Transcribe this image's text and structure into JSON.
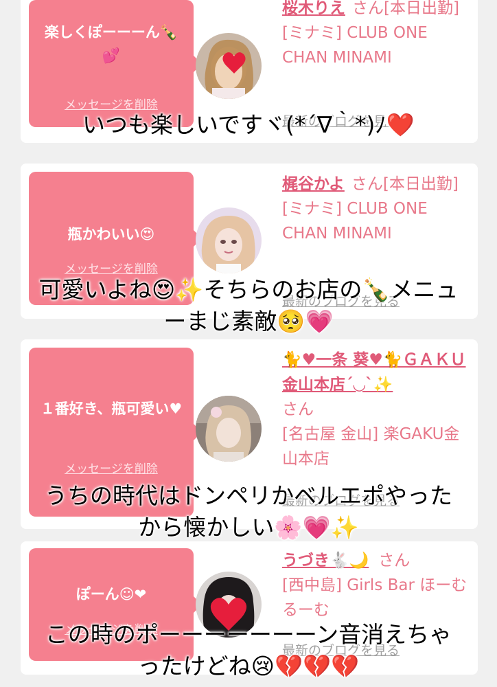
{
  "cards": [
    {
      "message": "楽しくぽーーーん🍾💕",
      "delete_label": "メッセージを削除",
      "name": "桜木りえ",
      "honorific_status": "さん[本日出勤]",
      "shop": "[ミナミ] CLUB ONE CHAN MINAMI",
      "blog_label": "最新のブログを見る",
      "avatar_icon": "heart-emoji-sticker"
    },
    {
      "message": "瓶かわいい😍",
      "delete_label": "メッセージを削除",
      "name": "梶谷かよ",
      "honorific_status": "さん[本日出勤]",
      "shop": "[ミナミ] CLUB ONE CHAN MINAMI",
      "blog_label": "最新のブログを見る",
      "avatar_icon": "avatar-photo"
    },
    {
      "message": "１番好き、瓶可愛い♥",
      "delete_label": "メッセージを削除",
      "name": "🐈♥一条 葵♥🐈ＧＡＫＵ金山本店´◡`✨",
      "honorific_status": "さん",
      "shop": "[名古屋 金山] 楽GAKU金山本店",
      "blog_label": "最新のブログを見る",
      "avatar_icon": "avatar-photo"
    },
    {
      "message": "ぽーん☺❤",
      "delete_label": "メッセージを削除",
      "name": "うづき🐇🌙",
      "honorific_status": "さん",
      "shop": "[西中島] Girls Bar ほーむるーむ",
      "blog_label": "最新のブログを見る",
      "avatar_icon": "heart-emoji-sticker"
    }
  ],
  "overlays": [
    "いつも楽しいですヾ(*´∇｀*)ﾉ❤️",
    "可愛いよね😍✨そちらのお店の🍾メニュ",
    "ーまじ素敵🥺💗",
    "うちの時代はドンペリかベルエポやった",
    "から懐かしい🌸💗✨",
    "この時のポーーーーーーーン音消えちゃ",
    "ったけどね😢💔💔💔"
  ],
  "colors": {
    "bubble": "#f5808f",
    "name": "#e05a78",
    "text": "#e8788a",
    "background": "#f0f0f0"
  }
}
